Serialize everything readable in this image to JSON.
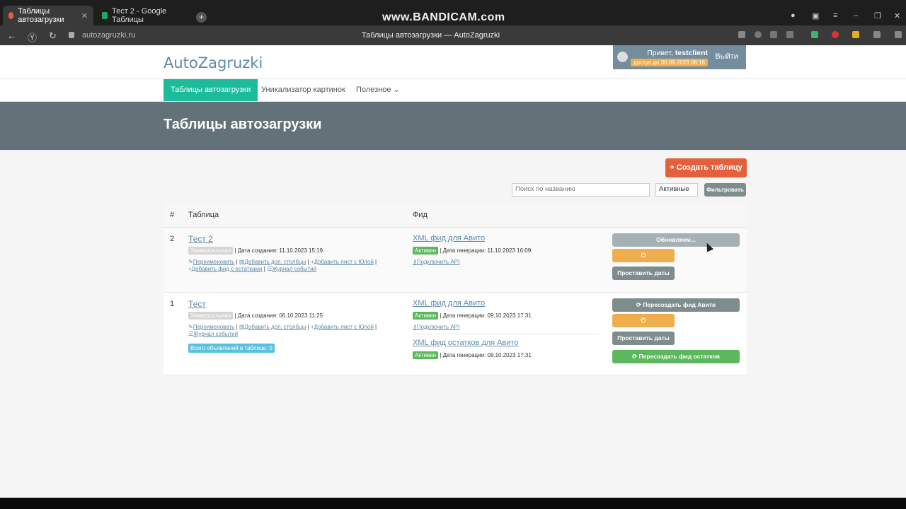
{
  "browser": {
    "tabs": [
      {
        "label": "Таблицы автозагрузки",
        "close": "✕"
      },
      {
        "label": "Тест 2 - Google Таблицы"
      }
    ],
    "new_tab": "+",
    "watermark": "www.BANDICAM.com",
    "url": "autozagruzki.ru",
    "page_title": "Таблицы автозагрузки — AutoZagruzki"
  },
  "header": {
    "logo": "AutoZagruzki",
    "greeting": "Привет,",
    "username": "testclient",
    "access": "доступ до 30.09.2023 08:16",
    "logout": "Выйти"
  },
  "nav": {
    "items": [
      {
        "label": "Таблицы автозагрузки"
      },
      {
        "label": "Уникализатор картинок"
      },
      {
        "label": "Полезное"
      }
    ]
  },
  "banner": {
    "title": "Таблицы автозагрузки"
  },
  "toolbar": {
    "create_label": "+ Создать таблицу",
    "search_placeholder": "Поиск по названию",
    "filter_select": "Активные",
    "filter_label": "Фильтровать"
  },
  "table": {
    "headers": {
      "num": "#",
      "name": "Таблица",
      "feed": "Фид"
    },
    "rows": [
      {
        "num": "2",
        "name": "Тест 2",
        "type": "Универсальная",
        "created": "| Дата создания: 11.10.2023 15:19",
        "links": [
          "Переименовать",
          "Добавить доп. столбцы",
          "Добавить лист с Юлой",
          "Добавить фид с остатками",
          "Журнал событий"
        ],
        "feeds": [
          {
            "name": "XML фид для Авито",
            "status": "Активен",
            "generated": "| Дата генерации: 11.10.2023 16:09",
            "api": "Подключить API"
          }
        ],
        "actions": {
          "updating": "Обновляем...",
          "power": "⏻",
          "dates": "Проставить даты"
        }
      },
      {
        "num": "1",
        "name": "Тест",
        "type": "Универсальная",
        "created": "| Дата создания: 06.10.2023 11:25",
        "links": [
          "Переименовать",
          "Добавить доп. столбцы",
          "Добавить лист с Юлой",
          "Журнал событий"
        ],
        "count": "Всего объявлений в таблице: 0",
        "feeds": [
          {
            "name": "XML фид для Авито",
            "status": "Активен",
            "generated": "| Дата генерации: 09.10.2023 17:31",
            "api": "Подключить API"
          },
          {
            "name": "XML фид остатков для Авито",
            "status": "Активен",
            "generated": "| Дата генерации: 09.10.2023 17:31"
          }
        ],
        "actions": {
          "recreate": "⟳ Пересоздать фид Авито",
          "power": "⏻",
          "dates": "Проставить даты",
          "recreate_stock": "⟳ Пересоздать фид остатков"
        }
      }
    ]
  },
  "colors": {
    "accent": "#1abc9c",
    "create": "#e4603c",
    "banner": "#637279",
    "logo": "#5f8aa8"
  }
}
